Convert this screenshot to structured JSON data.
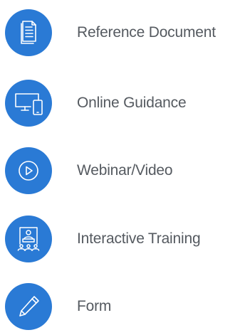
{
  "colors": {
    "badge": "#2a7ad5",
    "icon_stroke": "#ffffff",
    "label_text": "#555a60"
  },
  "items": [
    {
      "label": "Reference Document",
      "icon": "document-icon"
    },
    {
      "label": "Online Guidance",
      "icon": "devices-icon"
    },
    {
      "label": "Webinar/Video",
      "icon": "play-icon"
    },
    {
      "label": "Interactive Training",
      "icon": "presentation-icon"
    },
    {
      "label": "Form",
      "icon": "pencil-icon"
    }
  ]
}
